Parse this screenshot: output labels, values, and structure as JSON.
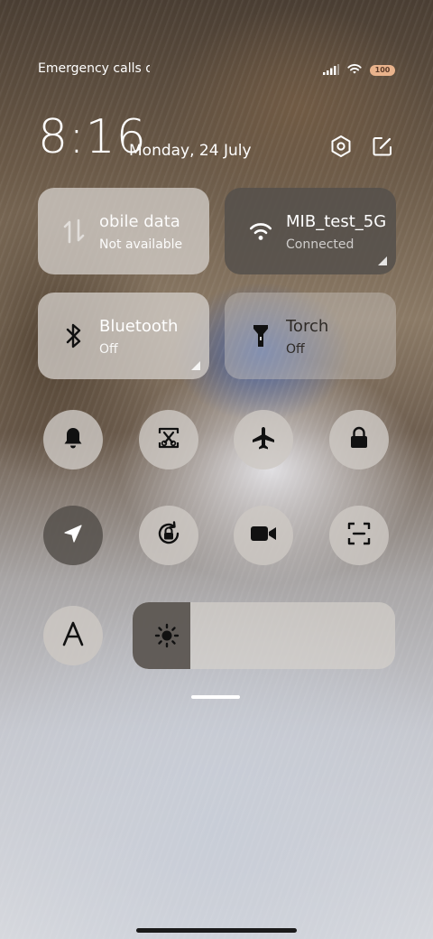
{
  "status_bar": {
    "carrier_text": "Emergency calls o",
    "battery_level": "100"
  },
  "header": {
    "time": "8:16",
    "date": "Monday, 24 July"
  },
  "tiles": {
    "mobile_data": {
      "label": "obile data",
      "status": "Not available"
    },
    "wifi": {
      "label": "MIB_test_5G",
      "status": "Connected"
    },
    "bluetooth": {
      "label": "Bluetooth",
      "status": "Off"
    },
    "torch": {
      "label": "Torch",
      "status": "Off"
    }
  },
  "toggles": {
    "row1": [
      "bell-icon",
      "screenshot-icon",
      "airplane-icon",
      "lock-icon"
    ],
    "row2": [
      "location-icon",
      "rotation-lock-icon",
      "video-camera-icon",
      "scanner-icon"
    ]
  },
  "brightness": {
    "level": 0.22,
    "icon": "sun-icon",
    "reading_mode_icon": "font-a-icon"
  },
  "colors": {
    "tile_active": "#55504b",
    "tile_inactive": "#d2cdc8",
    "battery": "#e9b38c"
  }
}
